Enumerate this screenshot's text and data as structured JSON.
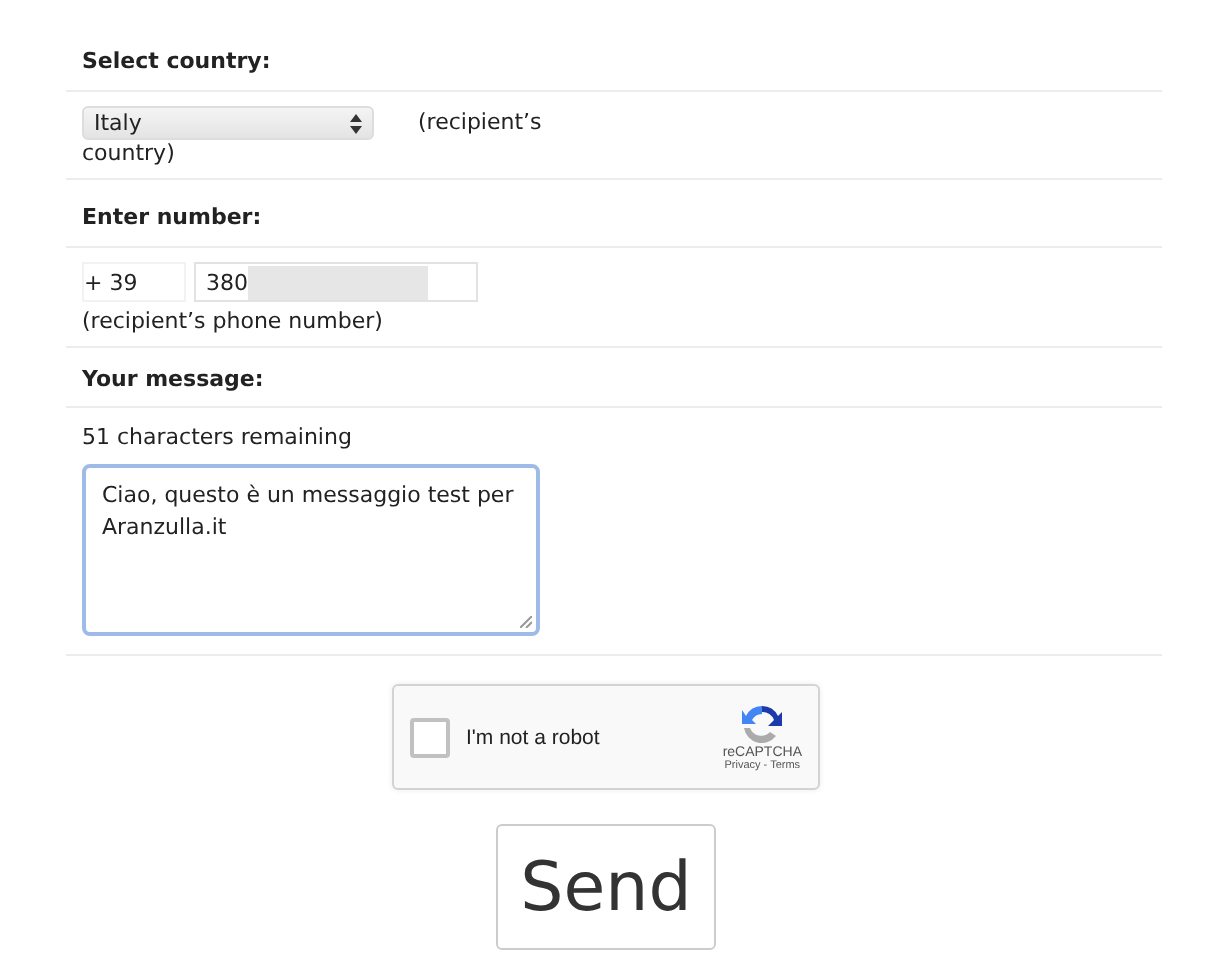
{
  "country": {
    "label": "Select country:",
    "value": "Italy",
    "hint_lines": [
      "(recipient’s",
      "country)"
    ]
  },
  "number": {
    "label": "Enter number:",
    "prefix": "+ 39",
    "value": "380",
    "redacted": true,
    "hint": "(recipient’s phone number)"
  },
  "message": {
    "label": "Your message:",
    "remaining": "51 characters remaining",
    "value": "Ciao, questo è un messaggio test per Aranzulla.it"
  },
  "captcha": {
    "label": "I'm not a robot",
    "checked": false,
    "brand": "reCAPTCHA",
    "links": "Privacy - Terms"
  },
  "send_button": "Send"
}
